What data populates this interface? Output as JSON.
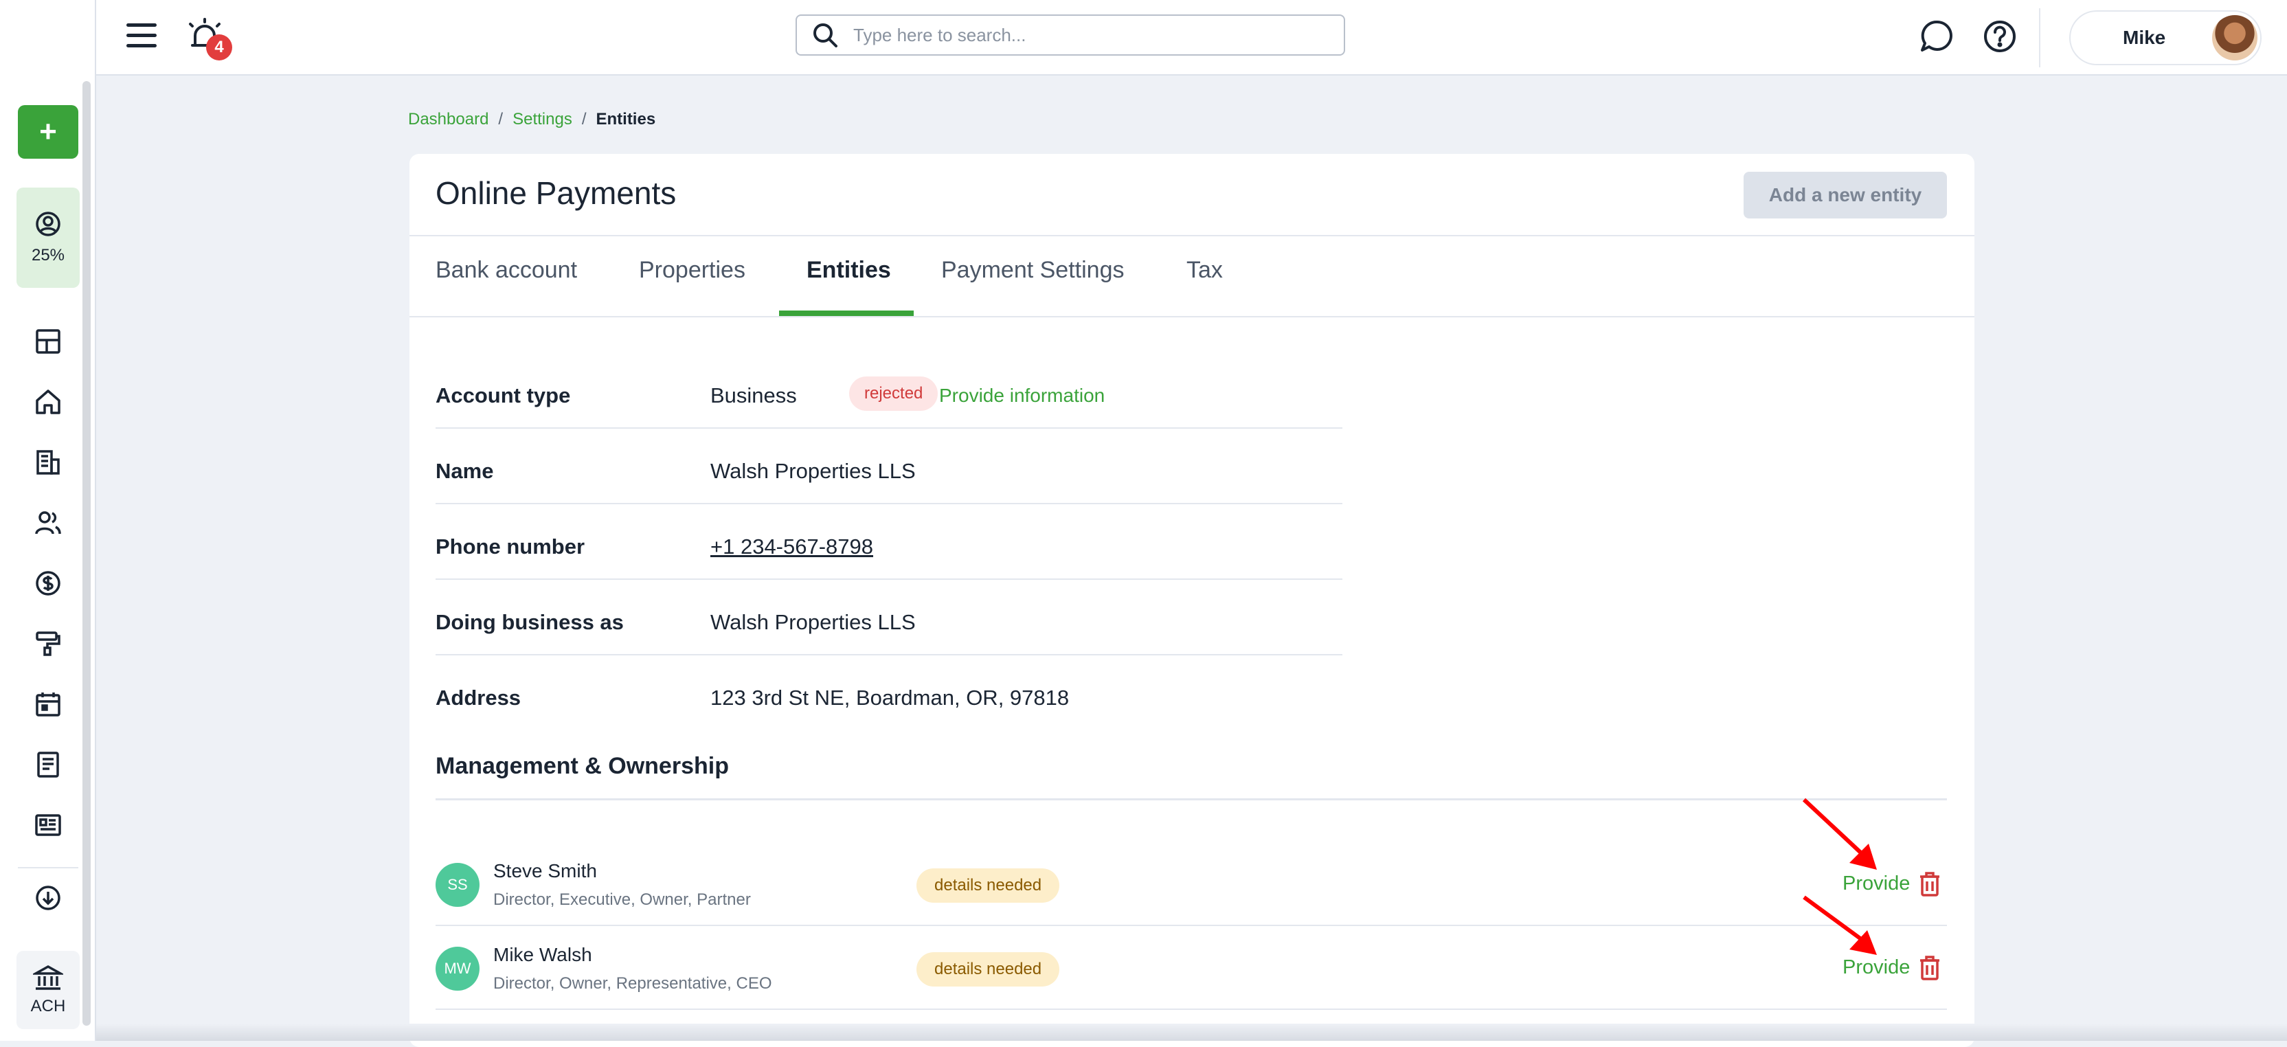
{
  "topbar": {
    "notification_count": "4",
    "search_placeholder": "Type here to search...",
    "user_name": "Mike"
  },
  "sidebar": {
    "progress_pct": "25%",
    "ach_label": "ACH"
  },
  "breadcrumb": {
    "items": [
      "Dashboard",
      "Settings"
    ],
    "current": "Entities",
    "separator": "/"
  },
  "card": {
    "title": "Online Payments",
    "add_button": "Add a new entity",
    "tabs": [
      {
        "label": "Bank account"
      },
      {
        "label": "Properties"
      },
      {
        "label": "Entities",
        "active": true
      },
      {
        "label": "Payment Settings"
      },
      {
        "label": "Tax"
      }
    ]
  },
  "details": {
    "account_type_label": "Account type",
    "account_type_value": "Business",
    "status": "rejected",
    "provide_info": "Provide information",
    "name_label": "Name",
    "name_value": "Walsh Properties LLS",
    "phone_label": "Phone number",
    "phone_value": "+1 234-567-8798",
    "dba_label": "Doing business as",
    "dba_value": "Walsh Properties LLS",
    "address_label": "Address",
    "address_value": "123 3rd St NE, Boardman, OR, 97818"
  },
  "management": {
    "title": "Management & Ownership",
    "owners": [
      {
        "initials": "SS",
        "name": "Steve Smith",
        "roles": "Director, Executive, Owner, Partner",
        "status": "details needed",
        "action": "Provide"
      },
      {
        "initials": "MW",
        "name": "Mike Walsh",
        "roles": "Director, Owner, Representative, CEO",
        "status": "details needed",
        "action": "Provide"
      }
    ]
  },
  "colors": {
    "accent": "#3aa33a",
    "danger": "#d03a3a",
    "annotation_arrow": "#ff0000"
  }
}
